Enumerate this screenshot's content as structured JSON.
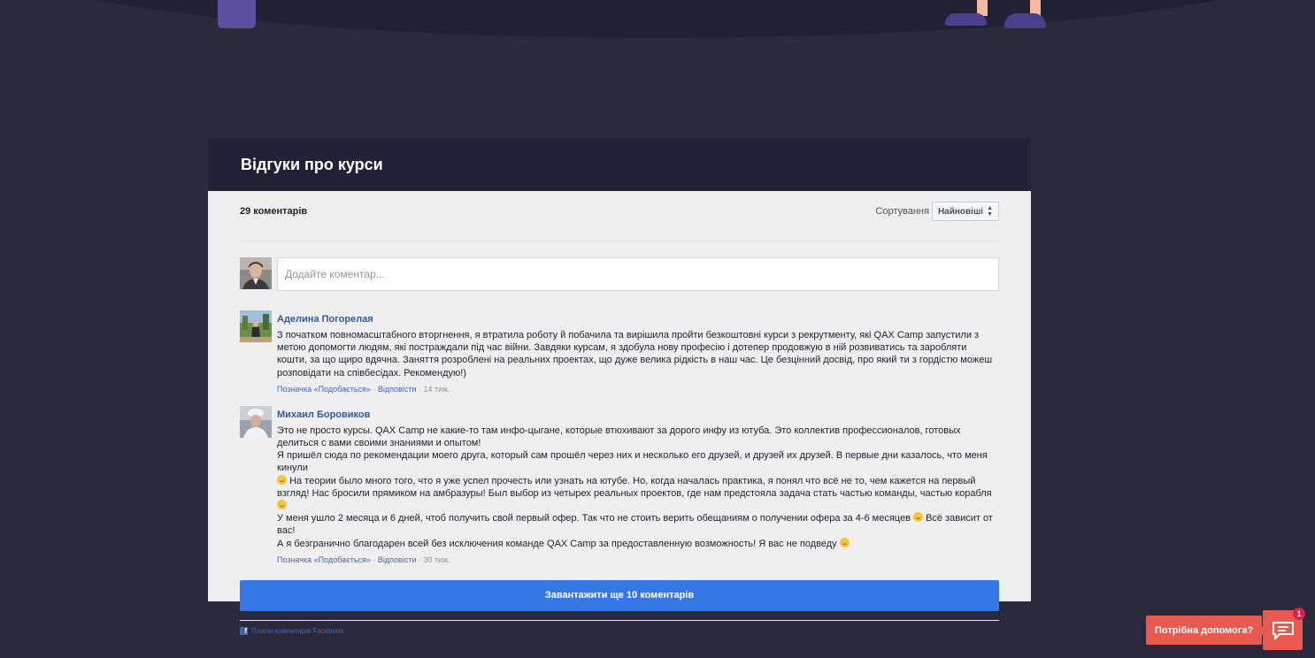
{
  "reviews": {
    "title": "Відгуки про курси"
  },
  "comments_plugin": {
    "count_label": "29 коментарів",
    "sort_label": "Сортування",
    "sort_selected": "Найновіші",
    "compose_placeholder": "Додайте коментар...",
    "comments": [
      {
        "author": "Аделина Погорелая",
        "paragraphs": [
          "З початком повномасштабного вторгнення, я втратила роботу й побачила та вирішила пройти безкоштовні курси з рекрутменту, які QAX Camp запустили з метою допомогти людям, які постраждали під час війни. Завдяки курсам, я здобула нову професію і дотепер продовжую в ній розвиватись та заробляти кошти, за що щиро вдячна. Заняття розроблені на реальних проектах, що дуже велика рідкість в наш час. Це безцінний досвід, про який ти з гордістю можеш розповідати на співбесідах. Рекомендую!)"
        ],
        "like_label": "Позначка «Подобається»",
        "reply_label": "Відповісти",
        "time": "14 тиж."
      },
      {
        "author": "Михаил Боровиков",
        "paragraphs": [
          "Это не просто курсы. QAX Camp не какие-то там инфо-цыгане, которые втюхивают за дорого инфу из ютуба. Это коллектив профессионалов, готовых делиться с вами своими знаниями и опытом!",
          "Я пришёл сюда по рекомендации моего друга, который сам прошёл через них и несколько его друзей, и друзей их друзей. В первые дни казалось, что меня кинули",
          "На теории было много того, что я уже успел прочесть или узнать на ютубе. Но, когда началась практика, я понял что всё не то, чем кажется на первый взгляд! Нас бросили прямиком на амбразуры! Был выбор из четырех реальных проектов, где нам предстояла задача стать частью команды, частью корабля",
          "У меня ушло 2 месяца и 6 дней, чтоб получить свой первый офер. Так что не стоить верить обещаниям о получении офера за 4-6 месяцев",
          "Всё зависит от вас!",
          "А я безгранично благодарен всей без исключения команде QAX Camp за предоставленную возможность! Я вас не подведу"
        ],
        "like_label": "Позначка «Подобається»",
        "reply_label": "Відповісти",
        "time": "30 тиж."
      }
    ],
    "load_more_label": "Завантажити ще 10 коментарів",
    "footer_label": "Плагін коментарів Facebook"
  },
  "help_widget": {
    "label": "Потрібна допомога?",
    "badge_count": "1"
  },
  "colors": {
    "page_background": "#2b2a3c",
    "header_background": "#232136",
    "card_background": "#efefef",
    "link_blue": "#365899",
    "button_blue": "#3578e5",
    "help_red": "#e8594f"
  }
}
